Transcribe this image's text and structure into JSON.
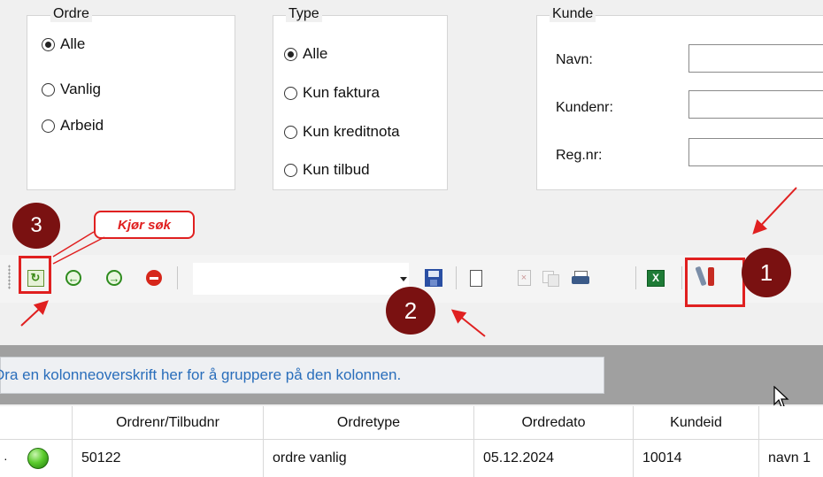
{
  "ordre_group": {
    "legend": "Ordre",
    "options": [
      "Alle",
      "Vanlig",
      "Arbeid"
    ],
    "selected": "Alle"
  },
  "type_group": {
    "legend": "Type",
    "options": [
      "Alle",
      "Kun faktura",
      "Kun kreditnota",
      "Kun tilbud"
    ],
    "selected": "Alle"
  },
  "kunde_group": {
    "legend": "Kunde",
    "fields": [
      {
        "label": "Navn:",
        "value": ""
      },
      {
        "label": "Kundenr:",
        "value": ""
      },
      {
        "label": "Reg.nr:",
        "value": ""
      }
    ]
  },
  "annotations": {
    "callout": "Kjør søk",
    "badge1": "1",
    "badge2": "2",
    "badge3": "3"
  },
  "toolbar": {
    "icons": [
      "refresh-search-icon",
      "back-icon",
      "forward-icon",
      "stop-icon",
      "dropdown-arrow-icon",
      "save-icon",
      "new-document-icon",
      "delete-icon",
      "copy-icon",
      "print-icon",
      "excel-icon",
      "settings-tools-icon"
    ],
    "search_text": ""
  },
  "grid": {
    "group_hint": "Dra en kolonneoverskrift her for å gruppere på den kolonnen.",
    "columns": [
      "Ordrenr/Tilbudnr",
      "Ordretype",
      "Ordredato",
      "Kundeid"
    ],
    "rows": [
      {
        "status": "green",
        "ordrenr": "50122",
        "ordretype": "ordre vanlig",
        "ordredato": "05.12.2024",
        "kundeid": "10014",
        "navn": "navn 1"
      }
    ]
  },
  "colors": {
    "annotation_red": "#e02020",
    "badge": "#7a1111",
    "hint_text": "#2a6ebb",
    "grey_band": "#a0a0a0"
  }
}
